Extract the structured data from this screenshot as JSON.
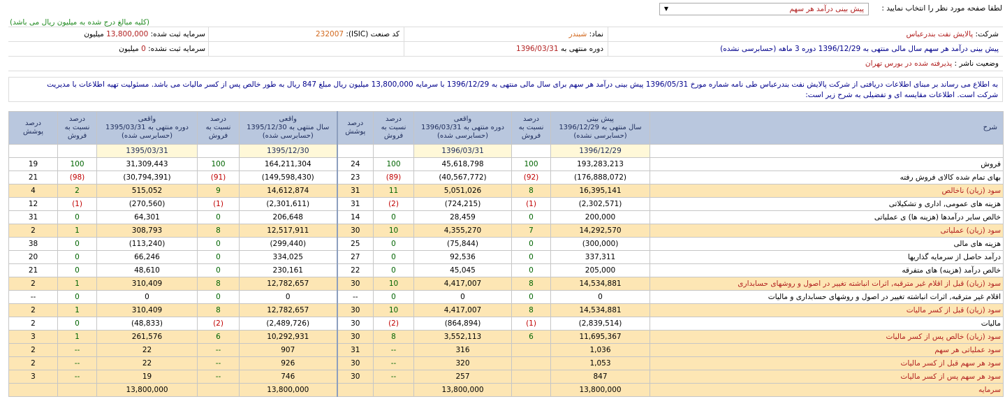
{
  "header": {
    "select_label": "لطفا صفحه مورد نظر را انتخاب نمایید :",
    "select_value": "پیش بینی درآمد هر سهم",
    "units_note": "(کلیه مبالغ درج شده به میلیون ریال می باشد)"
  },
  "info": {
    "company_label": "شرکت:",
    "company_value": "پالایش نفت بندرعباس",
    "symbol_label": "نماد:",
    "symbol_value": "شبندر",
    "isic_label": "کد صنعت (ISIC):",
    "isic_value": "232007",
    "registered_capital_label": "سرمایه ثبت شده:",
    "registered_capital_value": "13,800,000",
    "registered_capital_unit": "میلیون",
    "forecast_text": "پیش بینی درآمد هر سهم سال مالی منتهی به 1396/12/29 دوره 3 ماهه (حسابرسی نشده)",
    "period_label": "دوره منتهی به",
    "period_value": "1396/03/31",
    "unregistered_capital_label": "سرمایه ثبت نشده:",
    "unregistered_capital_value": "0",
    "unregistered_capital_unit": "میلیون",
    "publisher_status_label": "وضعیت ناشر :",
    "publisher_status_value": "پذیرفته شده در بورس تهران"
  },
  "notice": {
    "line1": "به اطلاع می رساند بر مبنای اطلاعات دریافتی از شرکت پالایش نفت بندرعباس طی نامه شماره مورخ 1396/05/31 پیش بینی درآمد هر سهم برای سال مالی منتهی به 1396/12/29 با سرمایه 13,800,000 میلیون ریال مبلغ 847 ریال به طور خالص پس از کسر مالیات می باشد. مسئولیت تهیه اطلاعات با مدیریت",
    "line2": "شرکت است. اطلاعات مقایسه ای و تفضیلی به شرح زیر است:"
  },
  "table": {
    "headers": {
      "desc": "شرح",
      "c1": [
        "پیش بینی",
        "سال منتهی به 1396/12/29",
        "(حسابرسی نشده)"
      ],
      "c2": [
        "درصد",
        "نسبت به",
        "فروش"
      ],
      "c3": [
        "واقعی",
        "دوره منتهی به 1396/03/31",
        "(حسابرسی شده)"
      ],
      "c4": [
        "درصد",
        "نسبت به",
        "فروش"
      ],
      "c5": [
        "درصد",
        "پوشش"
      ],
      "c6": [
        "واقعی",
        "سال منتهی به 1395/12/30",
        "(حسابرسی شده)"
      ],
      "c7": [
        "درصد",
        "نسبت به",
        "فروش"
      ],
      "c8": [
        "واقعی",
        "دوره منتهی به 1395/03/31",
        "(حسابرسی شده)"
      ],
      "c9": [
        "درصد",
        "نسبت به",
        "فروش"
      ],
      "c10": [
        "درصد",
        "پوشش"
      ]
    },
    "dates": [
      "1396/12/29",
      "1396/03/31",
      "1395/12/30",
      "1395/03/31"
    ],
    "rows": [
      {
        "desc": "فروش",
        "hl": false,
        "v": [
          "193,283,213",
          "100",
          "45,618,798",
          "100",
          "24",
          "164,211,304",
          "100",
          "31,309,443",
          "100",
          "19"
        ]
      },
      {
        "desc": "بهای تمام شده کالای فروش رفته",
        "hl": false,
        "v": [
          "(176,888,072)",
          "(92)",
          "(40,567,772)",
          "(89)",
          "23",
          "(149,598,430)",
          "(91)",
          "(30,794,391)",
          "(98)",
          "21"
        ]
      },
      {
        "desc": "سود (زیان) ناخالص",
        "hl": true,
        "v": [
          "16,395,141",
          "8",
          "5,051,026",
          "11",
          "31",
          "14,612,874",
          "9",
          "515,052",
          "2",
          "4"
        ]
      },
      {
        "desc": "هزینه های عمومی, اداری و تشکیلاتی",
        "hl": false,
        "v": [
          "(2,302,571)",
          "(1)",
          "(724,215)",
          "(2)",
          "31",
          "(2,301,611)",
          "(1)",
          "(270,560)",
          "(1)",
          "12"
        ]
      },
      {
        "desc": "خالص سایر درآمدها (هزینه ها) ی عملیاتی",
        "hl": false,
        "v": [
          "200,000",
          "0",
          "28,459",
          "0",
          "14",
          "206,648",
          "0",
          "64,301",
          "0",
          "31"
        ]
      },
      {
        "desc": "سود (زیان) عملیاتی",
        "hl": true,
        "v": [
          "14,292,570",
          "7",
          "4,355,270",
          "10",
          "30",
          "12,517,911",
          "8",
          "308,793",
          "1",
          "2"
        ]
      },
      {
        "desc": "هزینه های مالی",
        "hl": false,
        "v": [
          "(300,000)",
          "0",
          "(75,844)",
          "0",
          "25",
          "(299,440)",
          "0",
          "(113,240)",
          "0",
          "38"
        ]
      },
      {
        "desc": "درآمد حاصل از سرمایه گذاریها",
        "hl": false,
        "v": [
          "337,311",
          "0",
          "92,536",
          "0",
          "27",
          "334,025",
          "0",
          "66,246",
          "0",
          "20"
        ]
      },
      {
        "desc": "خالص درآمد (هزینه) های متفرقه",
        "hl": false,
        "v": [
          "205,000",
          "0",
          "45,045",
          "0",
          "22",
          "230,161",
          "0",
          "48,610",
          "0",
          "21"
        ]
      },
      {
        "desc": "سود (زیان) قبل از اقلام غیر مترقبه, اثرات انباشته تغییر در اصول و روشهای حسابداری",
        "hl": true,
        "v": [
          "14,534,881",
          "8",
          "4,417,007",
          "10",
          "30",
          "12,782,657",
          "8",
          "310,409",
          "1",
          "2"
        ]
      },
      {
        "desc": "اقلام غیر مترقبه, اثرات انباشته تغییر در اصول و روشهای حسابداری و مالیات",
        "hl": false,
        "v": [
          "0",
          "0",
          "0",
          "0",
          "--",
          "0",
          "0",
          "0",
          "0",
          "--"
        ]
      },
      {
        "desc": "سود (زیان) قبل از کسر مالیات",
        "hl": true,
        "v": [
          "14,534,881",
          "8",
          "4,417,007",
          "10",
          "30",
          "12,782,657",
          "8",
          "310,409",
          "1",
          "2"
        ]
      },
      {
        "desc": "مالیات",
        "hl": false,
        "v": [
          "(2,839,514)",
          "(1)",
          "(864,894)",
          "(2)",
          "30",
          "(2,489,726)",
          "(2)",
          "(48,833)",
          "0",
          "2"
        ]
      },
      {
        "desc": "سود (زیان) خالص پس از کسر مالیات",
        "hl": true,
        "v": [
          "11,695,367",
          "6",
          "3,552,113",
          "8",
          "30",
          "10,292,931",
          "6",
          "261,576",
          "1",
          "3"
        ]
      },
      {
        "desc": "سود عملیاتی هر سهم",
        "hl": true,
        "v": [
          "1,036",
          "",
          "316",
          "--",
          "31",
          "907",
          "--",
          "22",
          "--",
          "2"
        ]
      },
      {
        "desc": "سود هر سهم قبل از کسر مالیات",
        "hl": true,
        "v": [
          "1,053",
          "",
          "320",
          "--",
          "30",
          "926",
          "--",
          "22",
          "--",
          "2"
        ]
      },
      {
        "desc": "سود هر سهم پس از کسر مالیات",
        "hl": true,
        "v": [
          "847",
          "",
          "257",
          "--",
          "30",
          "746",
          "--",
          "19",
          "--",
          "3"
        ]
      },
      {
        "desc": "سرمایه",
        "hl": true,
        "v": [
          "13,800,000",
          "",
          "13,800,000",
          "",
          "",
          "13,800,000",
          "",
          "13,800,000",
          "",
          ""
        ]
      }
    ]
  },
  "colors": {
    "header_bg": "#b9c7de",
    "highlight_row": "#fde6b4",
    "negative": "#c00000",
    "positive_pct": "#006400"
  }
}
